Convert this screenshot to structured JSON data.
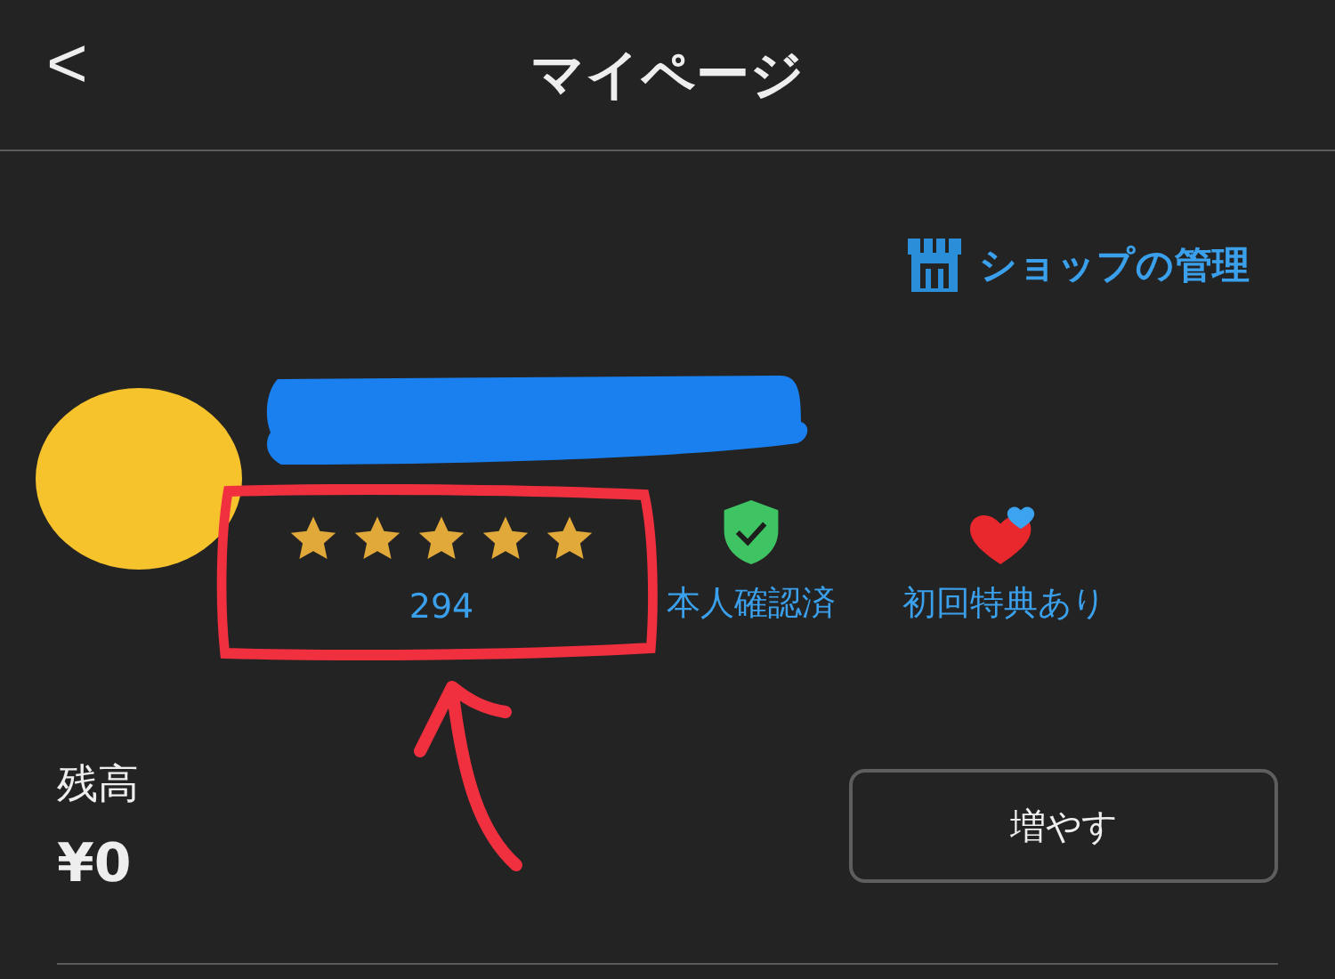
{
  "header": {
    "back": "<",
    "title": "マイページ"
  },
  "shop_link": {
    "label": "ショップの管理"
  },
  "profile": {
    "stars": 5,
    "review_count": "294",
    "badges": [
      {
        "kind": "verified",
        "label": "本人確認済"
      },
      {
        "kind": "first_time_perk",
        "label": "初回特典あり"
      }
    ]
  },
  "balance": {
    "label": "残高",
    "amount": "¥0",
    "button": "増やす"
  }
}
